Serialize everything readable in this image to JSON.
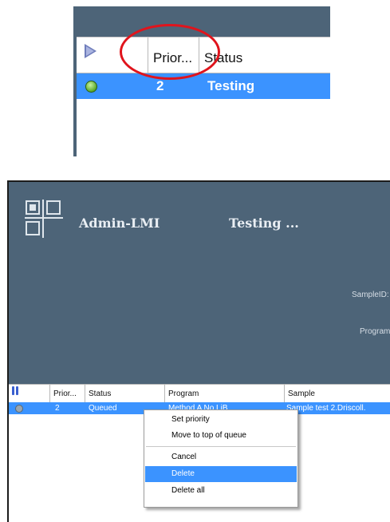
{
  "top_crop": {
    "columns": [
      "",
      "Prior...",
      "Status"
    ],
    "row": {
      "priority": "2",
      "status": "Testing"
    }
  },
  "app": {
    "user": "Admin-LMI",
    "state_title": "Testing ...",
    "sample_id_label": "SampleID:",
    "program_label": "Program",
    "columns": [
      "",
      "Prior...",
      "Status",
      "Program",
      "Sample"
    ],
    "row": {
      "priority": "2",
      "status": "Queued",
      "program": "Method A No LiB",
      "sample": "Sample test 2.Driscoll."
    }
  },
  "context_menu": {
    "items": [
      "Set priority",
      "Move to top of queue",
      "Cancel",
      "Delete",
      "Delete all"
    ],
    "selected": "Delete"
  },
  "colors": {
    "banner": "#4d6478",
    "selection": "#3b93ff",
    "highlight_circle": "#e0141c"
  }
}
